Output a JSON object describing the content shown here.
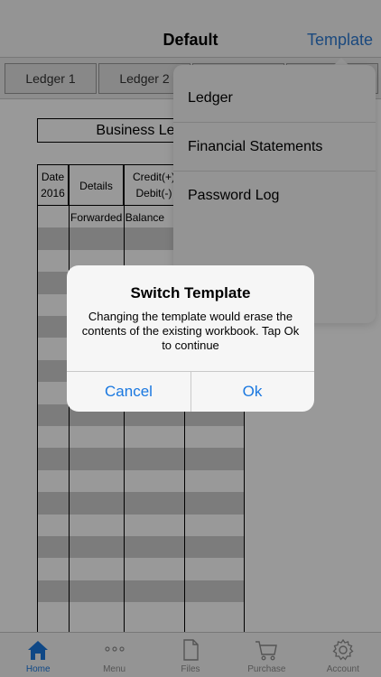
{
  "navbar": {
    "title": "Default",
    "right_button": "Template"
  },
  "tabs": [
    {
      "label": "Ledger 1"
    },
    {
      "label": "Ledger 2"
    },
    {
      "label": ""
    },
    {
      "label": ""
    }
  ],
  "sheet": {
    "title": "Business Ledger",
    "headers": {
      "date_line1": "Date",
      "date_line2": "2016",
      "details": "Details",
      "credit_line1": "Credit(+)",
      "credit_line2": "Debit(-)"
    },
    "forwarded_balance": "Forwarded Balance"
  },
  "template_menu": {
    "items": [
      {
        "label": "Ledger"
      },
      {
        "label": "Financial Statements"
      },
      {
        "label": "Password Log"
      }
    ]
  },
  "alert": {
    "title": "Switch Template",
    "message": "Changing the template would erase the contents of the existing workbook. Tap Ok to continue",
    "cancel_label": "Cancel",
    "ok_label": "Ok"
  },
  "bottom_tabs": [
    {
      "label": "Home",
      "icon": "home-icon",
      "active": true
    },
    {
      "label": "Menu",
      "icon": "more-dots-icon",
      "active": false
    },
    {
      "label": "Files",
      "icon": "file-icon",
      "active": false
    },
    {
      "label": "Purchase",
      "icon": "cart-icon",
      "active": false
    },
    {
      "label": "Account",
      "icon": "gear-icon",
      "active": false
    }
  ],
  "colors": {
    "accent": "#1a78e0",
    "nav_link": "#2d7bd3",
    "grey_row": "#cfcfcf"
  }
}
